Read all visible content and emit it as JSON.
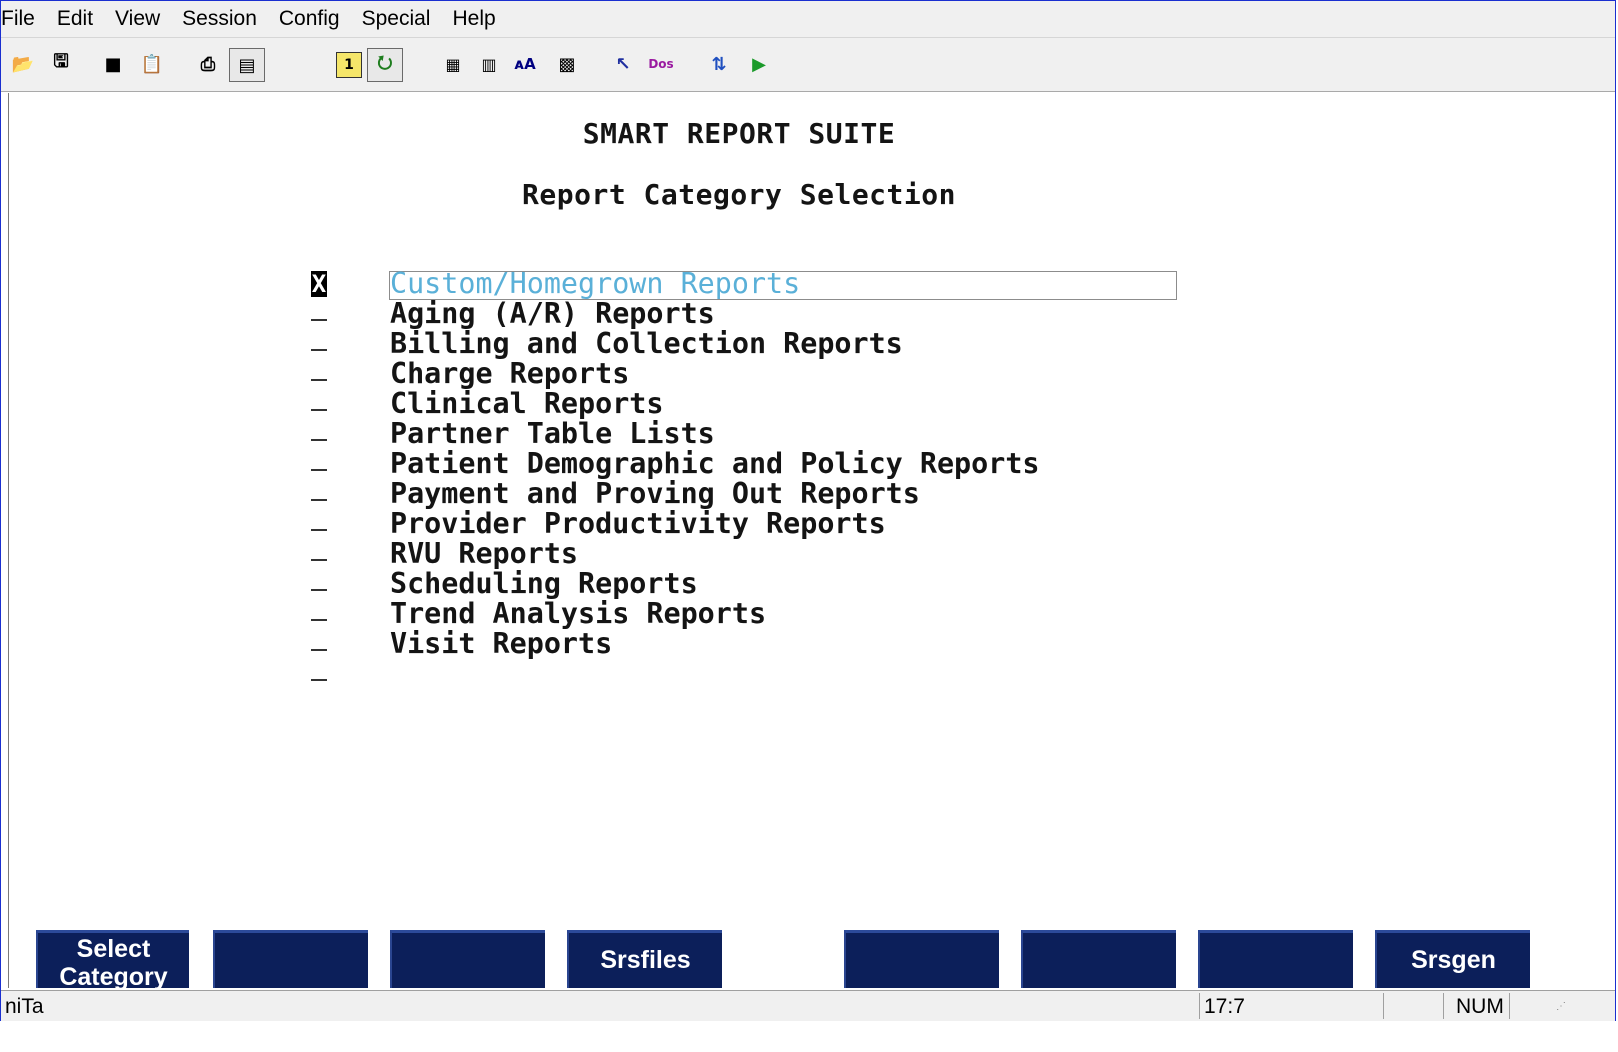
{
  "menu": [
    "File",
    "Edit",
    "View",
    "Session",
    "Config",
    "Special",
    "Help"
  ],
  "toolbar_icons": [
    "open-folder-icon",
    "save-disk-icon",
    "copy-icon",
    "paste-icon",
    "print-icon",
    "print-screen-icon",
    "info-icon",
    "macro-run-icon",
    "send-screen-icon",
    "receive-screen-icon",
    "font-size-icon",
    "keyboard-map-icon",
    "help-pointer-icon",
    "docs-icon",
    "transfer-icon",
    "play-icon"
  ],
  "screen": {
    "title": "SMART REPORT SUITE",
    "subtitle": "Report Category Selection",
    "items": [
      {
        "mark": "X",
        "label": "Custom/Homegrown Reports",
        "selected": true
      },
      {
        "mark": "_",
        "label": "Aging (A/R) Reports"
      },
      {
        "mark": "_",
        "label": "Billing and Collection Reports"
      },
      {
        "mark": "_",
        "label": "Charge Reports"
      },
      {
        "mark": "_",
        "label": "Clinical Reports"
      },
      {
        "mark": "_",
        "label": "Partner Table Lists"
      },
      {
        "mark": "_",
        "label": "Patient Demographic and Policy Reports"
      },
      {
        "mark": "_",
        "label": "Payment and Proving Out Reports"
      },
      {
        "mark": "_",
        "label": "Provider Productivity Reports"
      },
      {
        "mark": "_",
        "label": "RVU Reports"
      },
      {
        "mark": "_",
        "label": "Scheduling Reports"
      },
      {
        "mark": "_",
        "label": "Trend Analysis Reports"
      },
      {
        "mark": "_",
        "label": "Visit Reports"
      }
    ]
  },
  "fkeys": [
    "Select Category",
    "",
    "",
    "Srsfiles",
    "",
    "",
    "",
    "Srsgen"
  ],
  "status": {
    "left": "niTa",
    "cursor": "17:7",
    "num": "NUM"
  },
  "colors": {
    "fkey_bg": "#0c1f5a",
    "selected_text": "#5ab0d8",
    "frame": "#1a2fd0"
  }
}
